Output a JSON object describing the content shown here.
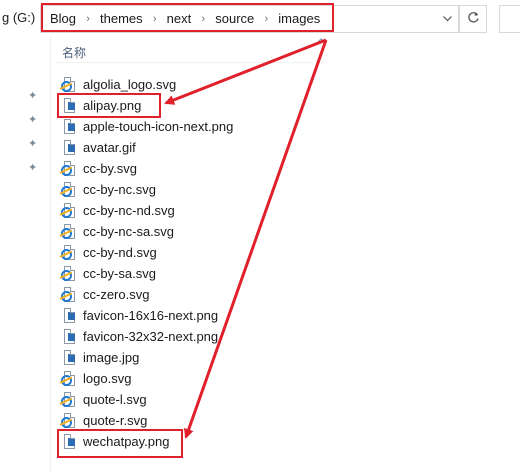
{
  "address_bar": {
    "drive_label": "g (G:)",
    "breadcrumbs": [
      "Blog",
      "themes",
      "next",
      "source",
      "images"
    ],
    "separator": "›",
    "dropdown_icon": "chevron-down-icon",
    "refresh_icon": "refresh-icon"
  },
  "file_list": {
    "column_header": "名称",
    "items": [
      {
        "name": "algolia_logo.svg",
        "icon": "svg-file-icon"
      },
      {
        "name": "alipay.png",
        "icon": "png-file-icon"
      },
      {
        "name": "apple-touch-icon-next.png",
        "icon": "png-file-icon"
      },
      {
        "name": "avatar.gif",
        "icon": "gif-file-icon"
      },
      {
        "name": "cc-by.svg",
        "icon": "svg-file-icon"
      },
      {
        "name": "cc-by-nc.svg",
        "icon": "svg-file-icon"
      },
      {
        "name": "cc-by-nc-nd.svg",
        "icon": "svg-file-icon"
      },
      {
        "name": "cc-by-nc-sa.svg",
        "icon": "svg-file-icon"
      },
      {
        "name": "cc-by-nd.svg",
        "icon": "svg-file-icon"
      },
      {
        "name": "cc-by-sa.svg",
        "icon": "svg-file-icon"
      },
      {
        "name": "cc-zero.svg",
        "icon": "svg-file-icon"
      },
      {
        "name": "favicon-16x16-next.png",
        "icon": "png-file-icon"
      },
      {
        "name": "favicon-32x32-next.png",
        "icon": "png-file-icon"
      },
      {
        "name": "image.jpg",
        "icon": "jpg-file-icon"
      },
      {
        "name": "logo.svg",
        "icon": "svg-file-icon"
      },
      {
        "name": "quote-l.svg",
        "icon": "svg-file-icon"
      },
      {
        "name": "quote-r.svg",
        "icon": "svg-file-icon"
      },
      {
        "name": "wechatpay.png",
        "icon": "png-file-icon"
      }
    ]
  },
  "annotation_color": "#e0202a"
}
